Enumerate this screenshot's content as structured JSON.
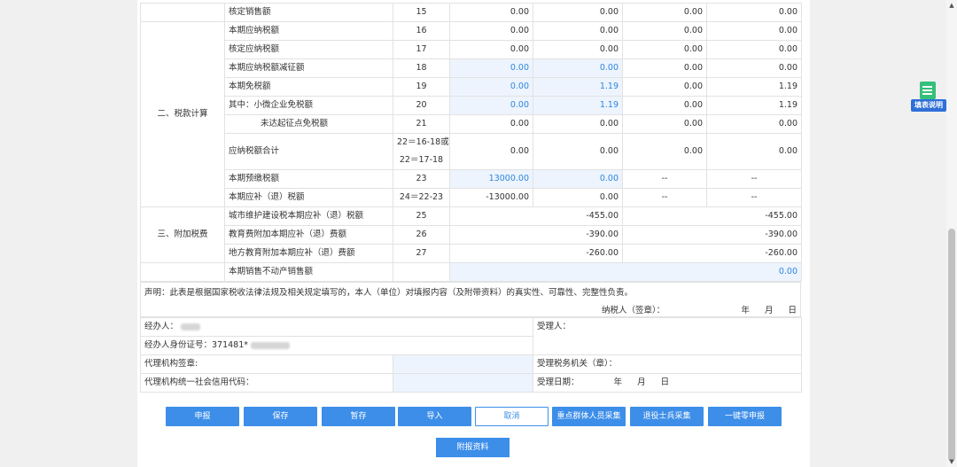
{
  "rows": [
    {
      "item": "核定销售额",
      "seq": "15",
      "c1": "0.00",
      "c2": "0.00",
      "c3": "0.00",
      "c4": "0.00"
    },
    {
      "item": "本期应纳税额",
      "seq": "16",
      "c1": "0.00",
      "c2": "0.00",
      "c3": "0.00",
      "c4": "0.00"
    },
    {
      "item": "核定应纳税额",
      "seq": "17",
      "c1": "0.00",
      "c2": "0.00",
      "c3": "0.00",
      "c4": "0.00"
    },
    {
      "item": "本期应纳税额减征额",
      "seq": "18",
      "c1": "0.00",
      "c2": "0.00",
      "c3": "0.00",
      "c4": "0.00"
    },
    {
      "item": "本期免税额",
      "seq": "19",
      "c1": "0.00",
      "c2": "1.19",
      "c3": "0.00",
      "c4": "1.19"
    },
    {
      "item": "其中：小微企业免税额",
      "seq": "20",
      "c1": "0.00",
      "c2": "1.19",
      "c3": "0.00",
      "c4": "1.19"
    },
    {
      "item": "未达起征点免税额",
      "seq": "21",
      "c1": "0.00",
      "c2": "0.00",
      "c3": "0.00",
      "c4": "0.00"
    },
    {
      "item": "应纳税额合计",
      "seq_a": "22＝16-18或",
      "seq_b": "22＝17-18",
      "c1": "0.00",
      "c2": "0.00",
      "c3": "0.00",
      "c4": "0.00"
    },
    {
      "item": "本期预缴税额",
      "seq": "23",
      "c1": "13000.00",
      "c2": "0.00",
      "c3": "--",
      "c4": "--"
    },
    {
      "item": "本期应补（退）税额",
      "seq": "24＝22-23",
      "c1": "-13000.00",
      "c2": "0.00",
      "c3": "--",
      "c4": "--"
    },
    {
      "item": "城市维护建设税本期应补（退）税额",
      "seq": "25",
      "a": "-455.00",
      "b": "-455.00"
    },
    {
      "item": "教育费附加本期应补（退）费额",
      "seq": "26",
      "a": "-390.00",
      "b": "-390.00"
    },
    {
      "item": "地方教育附加本期应补（退）费额",
      "seq": "27",
      "a": "-260.00",
      "b": "-260.00"
    },
    {
      "item": "本期销售不动产销售额",
      "seq": "",
      "v": "0.00"
    }
  ],
  "sections": {
    "tax_calc": "二、税款计算",
    "surcharge": "三、附加税费"
  },
  "declaration": {
    "text": "声明：此表是根据国家税收法律法规及相关规定填写的，本人（单位）对填报内容（及附带资料）的真实性、可靠性、完整性负责。",
    "taxpayer_sign": "纳税人（签章）：",
    "date": "年 月 日"
  },
  "signature": {
    "handler": "经办人：",
    "handler_id": "经办人身份证号：371481*",
    "receiver": "受理人：",
    "agency_seal": "代理机构签章:",
    "agency_code": "代理机构统一社会信用代码：",
    "tax_office": "受理税务机关（章）：",
    "accept_date": "受理日期：",
    "accept_date_ymd": "年 月 日"
  },
  "buttons": [
    "申报",
    "保存",
    "暂存",
    "导入",
    "取消",
    "重点群体人员采集",
    "退役士兵采集",
    "一键零申报"
  ],
  "attach_button": "附报资料",
  "help_label": "填表说明"
}
